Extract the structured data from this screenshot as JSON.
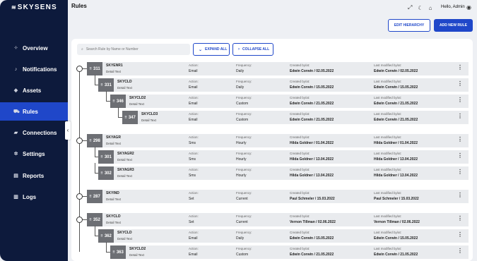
{
  "app": {
    "brand": "SKYSENS"
  },
  "sidebar": {
    "items": [
      {
        "label": "Overview",
        "icon": "overview-icon",
        "glyph": "⁘"
      },
      {
        "label": "Notifications",
        "icon": "bell-icon",
        "glyph": "♪"
      },
      {
        "label": "Assets",
        "icon": "assets-icon",
        "glyph": "◈"
      },
      {
        "label": "Rules",
        "icon": "rules-icon",
        "glyph": "⛟",
        "active": true
      },
      {
        "label": "Connections",
        "icon": "connections-icon",
        "glyph": "▰"
      },
      {
        "label": "Settings",
        "icon": "gear-icon",
        "glyph": "✲"
      },
      {
        "label": "Reports",
        "icon": "reports-icon",
        "glyph": "▤"
      },
      {
        "label": "Logs",
        "icon": "logs-icon",
        "glyph": "▥"
      }
    ]
  },
  "header": {
    "title": "Rules",
    "greeting": "Hello, Admin",
    "edit_hierarchy": "EDIT HIERARCHY",
    "add_new_rule": "ADD NEW RULE"
  },
  "toolbar": {
    "search_placeholder": "Search Rule by Name or Number",
    "expand_all": "EXPAND ALL",
    "collapse_all": "COLLAPSE ALL"
  },
  "labels": {
    "action": "Action:",
    "frequency": "Frequency:",
    "created": "Created by/at:",
    "modified": "Last modified by/at:"
  },
  "rules": [
    {
      "id": "311",
      "name": "SKYENR1",
      "detail": "Detail Text",
      "action": "Email",
      "frequency": "Daily",
      "created": "Edwin Corwin / 02.05.2022",
      "modified": "Edwin Corwin / 02.05.2022",
      "level": 0
    },
    {
      "id": "331",
      "name": "SKYCLD",
      "detail": "Detail Text",
      "action": "Email",
      "frequency": "Daily",
      "created": "Edwin Corwin / 15.05.2022",
      "modified": "Edwin Corwin / 15.05.2022",
      "level": 1
    },
    {
      "id": "346",
      "name": "SKYCLD2",
      "detail": "Detail Text",
      "action": "Email",
      "frequency": "Custom",
      "created": "Edwin Corwin / 21.05.2022",
      "modified": "Edwin Corwin / 21.05.2022",
      "level": 2
    },
    {
      "id": "347",
      "name": "SKYCLD3",
      "detail": "Detail Text",
      "action": "Email",
      "frequency": "Custom",
      "created": "Edwin Corwin / 21.05.2022",
      "modified": "Edwin Corwin / 21.05.2022",
      "level": 3
    },
    {
      "id": "298",
      "name": "SKYAGR",
      "detail": "Detail Text",
      "action": "Sms",
      "frequency": "Hourly",
      "created": "Hilda Goldner / 01.04.2022",
      "modified": "Hilda Goldner / 01.04.2022",
      "level": 0
    },
    {
      "id": "301",
      "name": "SKYAGR2",
      "detail": "Detail Text",
      "action": "Sms",
      "frequency": "Hourly",
      "created": "Hilda Goldner / 13.04.2022",
      "modified": "Hilda Goldner / 13.04.2022",
      "level": 1
    },
    {
      "id": "302",
      "name": "SKYAGR3",
      "detail": "Detail Text",
      "action": "Sms",
      "frequency": "Hourly",
      "created": "Hilda Goldner / 13.04.2022",
      "modified": "Hilda Goldner / 13.04.2022",
      "level": 1
    },
    {
      "id": "287",
      "name": "SKYIND",
      "detail": "Detail Text",
      "action": "Set",
      "frequency": "Current",
      "created": "Paul Schmeler / 15.03.2022",
      "modified": "Paul Schmeler / 15.03.2022",
      "level": 0
    },
    {
      "id": "352",
      "name": "SKYCLD",
      "detail": "Detail Text",
      "action": "Set",
      "frequency": "Current",
      "created": "Vernon Tillman / 02.06.2022",
      "modified": "Vernon Tillman / 02.06.2022",
      "level": 0
    },
    {
      "id": "362",
      "name": "SKYCLD",
      "detail": "Detail Text",
      "action": "Email",
      "frequency": "Daily",
      "created": "Edwin Corwin / 15.05.2022",
      "modified": "Edwin Corwin / 15.05.2022",
      "level": 1
    },
    {
      "id": "363",
      "name": "SKYCLD2",
      "detail": "Detail Text",
      "action": "Email",
      "frequency": "Custom",
      "created": "Edwin Corwin / 21.05.2022",
      "modified": "Edwin Corwin / 21.05.2022",
      "level": 2
    }
  ]
}
